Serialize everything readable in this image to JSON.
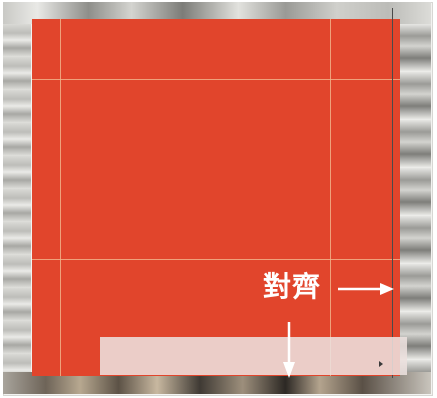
{
  "canvas": {
    "fill_color": "#e1452c",
    "guide_color": "#f1b189"
  },
  "annotation": {
    "label": "對齊",
    "arrow_right_icon": "arrow-right-icon",
    "arrow_down_icon": "arrow-down-icon"
  }
}
